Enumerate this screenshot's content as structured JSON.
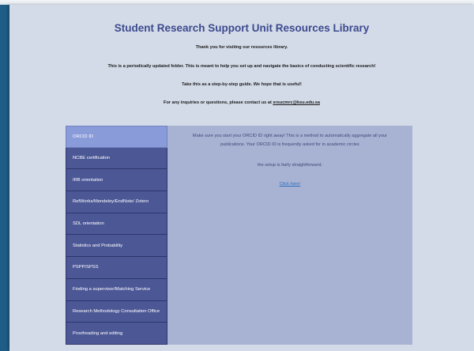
{
  "page": {
    "title": "Student Research Support Unit Resources Library",
    "intro": {
      "welcome": "Thank you for visiting our resources library.",
      "description": "This is a periodically updated folder. This is meant to help you set up and navigate the basics of conducting scientific research!",
      "guide": "Take this as a step-by-step guide. We hope that is useful!",
      "contact_prefix": "For any inquiries or questions, please contact us at ",
      "contact_email": "srsucmrc@ksu.edu.sa"
    }
  },
  "tabs": [
    {
      "label": "ORCID ID",
      "active": true
    },
    {
      "label": "NCBE certification"
    },
    {
      "label": "IRB orientation"
    },
    {
      "label": "RefWorks/Mendeley/EndNote/ Zotero"
    },
    {
      "label": "SDL orientation"
    },
    {
      "label": "Statistics and Probability"
    },
    {
      "label": "PSPP/SPSS"
    },
    {
      "label": "Finding a supervisor/Matching Service"
    },
    {
      "label": "Research Methodology Consultation Office"
    },
    {
      "label": "Proofreading and editing"
    }
  ],
  "content": {
    "paragraph1": "Make sure you start your ORCID ID right away! This is a method to automatically  aggregate  all  your publications.  Your  ORCID  ID is frequently asked for in academic circles",
    "paragraph2": "the setup is fairly straightforward.",
    "link_label": "Click here!"
  },
  "colors": {
    "header_title": "#3d4a8e",
    "tab_bg": "#4c5796",
    "tab_active_bg": "#8a9bd9",
    "content_bg": "#a8b2d3",
    "panel_bg": "#d3dbe8",
    "frame_bg": "#1f5c86",
    "link": "#2a6fc2"
  }
}
